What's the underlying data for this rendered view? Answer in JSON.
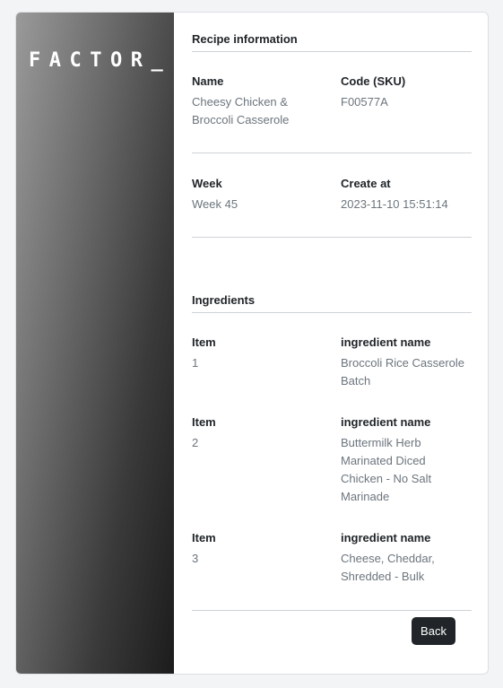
{
  "brand": {
    "logo_text": "FACTOR_"
  },
  "recipe_info": {
    "title": "Recipe information",
    "name_label": "Name",
    "name_value": "Cheesy Chicken & Broccoli Casserole",
    "code_label": "Code (SKU)",
    "code_value": "F00577A",
    "week_label": "Week",
    "week_value": "Week 45",
    "created_label": "Create at",
    "created_value": "2023-11-10 15:51:14"
  },
  "ingredients": {
    "title": "Ingredients",
    "item_label": "Item",
    "name_label": "ingredient name",
    "rows": [
      {
        "item": "1",
        "name": "Broccoli Rice Casserole Batch"
      },
      {
        "item": "2",
        "name": "Buttermilk Herb Marinated Diced Chicken - No Salt Marinade"
      },
      {
        "item": "3",
        "name": "Cheese, Cheddar, Shredded - Bulk"
      }
    ]
  },
  "actions": {
    "back_label": "Back"
  },
  "colors": {
    "button_bg": "#212529",
    "muted_text": "#6c757d",
    "label_text": "#212529",
    "page_bg": "#f3f4f6"
  }
}
